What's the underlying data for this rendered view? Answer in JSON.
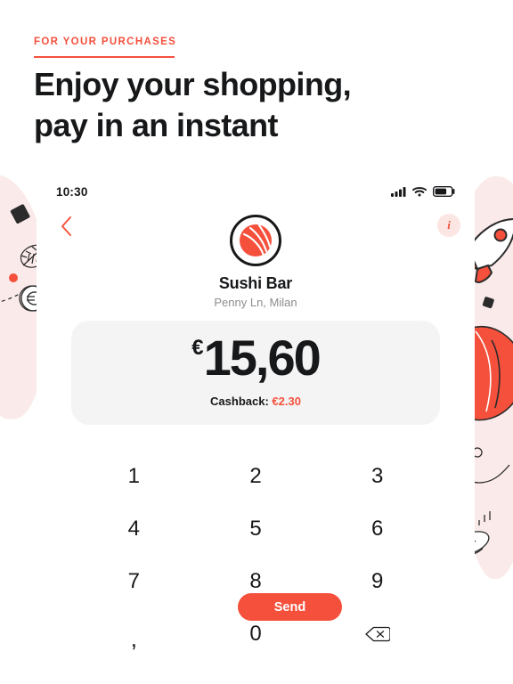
{
  "hero": {
    "eyebrow": "FOR YOUR PURCHASES",
    "headline_line1": "Enjoy your shopping,",
    "headline_line2": "pay in an instant",
    "accent_color": "#f4503c",
    "text_color": "#17181a"
  },
  "phone": {
    "status": {
      "time": "10:30",
      "signal_icon": "cellular-signal-icon",
      "wifi_icon": "wifi-icon",
      "battery_icon": "battery-icon",
      "battery_level_pct": 70
    },
    "nav": {
      "back_icon": "chevron-left-icon",
      "info_label": "i",
      "info_icon": "info-icon"
    },
    "merchant": {
      "avatar_icon": "sushi-ball-avatar-icon",
      "name": "Sushi Bar",
      "address": "Penny Ln, Milan"
    },
    "amount_card": {
      "currency_symbol": "€",
      "amount": "15,60",
      "cashback_label": "Cashback:",
      "cashback_value": "€2.30",
      "cashback_color": "#f4503c",
      "card_background": "#f4f4f4"
    },
    "send_button": {
      "label": "Send",
      "background": "#f4503c",
      "text_color": "#ffffff"
    },
    "keypad": {
      "keys": [
        {
          "label": "1",
          "name": "key-1"
        },
        {
          "label": "2",
          "name": "key-2"
        },
        {
          "label": "3",
          "name": "key-3"
        },
        {
          "label": "4",
          "name": "key-4"
        },
        {
          "label": "5",
          "name": "key-5"
        },
        {
          "label": "6",
          "name": "key-6"
        },
        {
          "label": "7",
          "name": "key-7"
        },
        {
          "label": "8",
          "name": "key-8"
        },
        {
          "label": "9",
          "name": "key-9"
        },
        {
          "label": ",",
          "name": "key-comma"
        },
        {
          "label": "0",
          "name": "key-0"
        },
        {
          "label": "",
          "name": "key-backspace"
        }
      ],
      "backspace_icon": "backspace-delete-icon"
    }
  },
  "decorations": {
    "left_blob_color": "#fbeaea",
    "right_blob_color": "#fbeaea",
    "items": [
      "black-diamond-icon",
      "leaf-icon",
      "red-dot-icon",
      "dashed-line-icon",
      "euro-coin-icon",
      "rocket-icon",
      "red-ball-icon",
      "small-circle-icon",
      "wavy-line-icon",
      "stacked-coin-icon",
      "black-square-icon"
    ]
  }
}
